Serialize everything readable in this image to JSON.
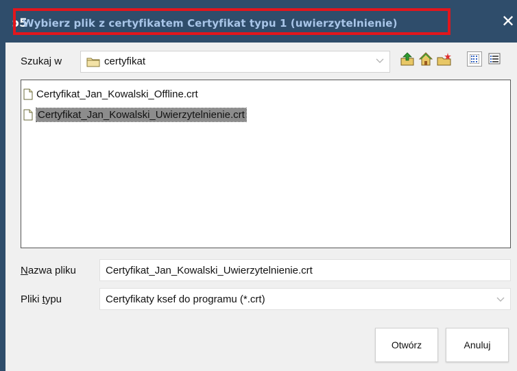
{
  "dialog": {
    "app_logo": "ɔ5",
    "title": "Wybierz plik z certyfikatem Certyfikat typu 1 (uwierzytelnienie)",
    "close_glyph": "✕"
  },
  "look_in": {
    "label": "Szukaj w",
    "value": "certyfikat"
  },
  "toolbar": {
    "icons": [
      "up-folder-icon",
      "home-icon",
      "new-folder-icon",
      "list-view-icon",
      "details-view-icon"
    ]
  },
  "files": [
    {
      "name": "Certyfikat_Jan_Kowalski_Offline.crt",
      "selected": false
    },
    {
      "name": "Certyfikat_Jan_Kowalski_Uwierzytelnienie.crt",
      "selected": true
    }
  ],
  "filename": {
    "label_underlined": "N",
    "label_rest": "azwa pliku",
    "value": "Certyfikat_Jan_Kowalski_Uwierzytelnienie.crt"
  },
  "filetype": {
    "label_pre": "Pliki ",
    "label_underlined": "t",
    "label_rest": "ypu",
    "value": "Certyfikaty ksef do programu (*.crt)"
  },
  "buttons": {
    "open": "Otwórz",
    "cancel": "Anuluj"
  },
  "colors": {
    "titlebar": "#2f4d6b",
    "title_text": "#a8c5e8",
    "highlight": "#e3161c",
    "selection": "#8c8c8c"
  }
}
